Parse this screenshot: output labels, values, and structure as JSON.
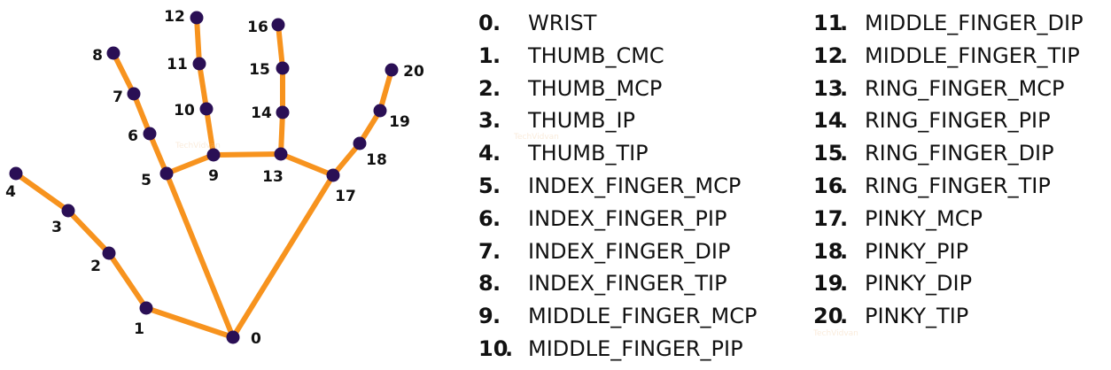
{
  "landmarks": [
    {
      "id": "0",
      "name": "WRIST"
    },
    {
      "id": "1",
      "name": "THUMB_CMC"
    },
    {
      "id": "2",
      "name": "THUMB_MCP"
    },
    {
      "id": "3",
      "name": "THUMB_IP"
    },
    {
      "id": "4",
      "name": "THUMB_TIP"
    },
    {
      "id": "5",
      "name": "INDEX_FINGER_MCP"
    },
    {
      "id": "6",
      "name": "INDEX_FINGER_PIP"
    },
    {
      "id": "7",
      "name": "INDEX_FINGER_DIP"
    },
    {
      "id": "8",
      "name": "INDEX_FINGER_TIP"
    },
    {
      "id": "9",
      "name": "MIDDLE_FINGER_MCP"
    },
    {
      "id": "10",
      "name": "MIDDLE_FINGER_PIP"
    },
    {
      "id": "11",
      "name": "MIDDLE_FINGER_DIP"
    },
    {
      "id": "12",
      "name": "MIDDLE_FINGER_TIP"
    },
    {
      "id": "13",
      "name": "RING_FINGER_MCP"
    },
    {
      "id": "14",
      "name": "RING_FINGER_PIP"
    },
    {
      "id": "15",
      "name": "RING_FINGER_DIP"
    },
    {
      "id": "16",
      "name": "RING_FINGER_TIP"
    },
    {
      "id": "17",
      "name": "PINKY_MCP"
    },
    {
      "id": "18",
      "name": "PINKY_PIP"
    },
    {
      "id": "19",
      "name": "PINKY_DIP"
    },
    {
      "id": "20",
      "name": "PINKY_TIP"
    }
  ],
  "connections": [
    [
      0,
      1
    ],
    [
      1,
      2
    ],
    [
      2,
      3
    ],
    [
      3,
      4
    ],
    [
      0,
      5
    ],
    [
      5,
      6
    ],
    [
      6,
      7
    ],
    [
      7,
      8
    ],
    [
      5,
      9
    ],
    [
      9,
      10
    ],
    [
      10,
      11
    ],
    [
      11,
      12
    ],
    [
      9,
      13
    ],
    [
      13,
      14
    ],
    [
      14,
      15
    ],
    [
      15,
      16
    ],
    [
      13,
      17
    ],
    [
      0,
      17
    ],
    [
      17,
      18
    ],
    [
      18,
      19
    ],
    [
      19,
      20
    ]
  ],
  "watermark": "TechVidvan",
  "colors": {
    "bone": "#f7931e",
    "joint": "#2a0f55",
    "text": "#111111"
  }
}
